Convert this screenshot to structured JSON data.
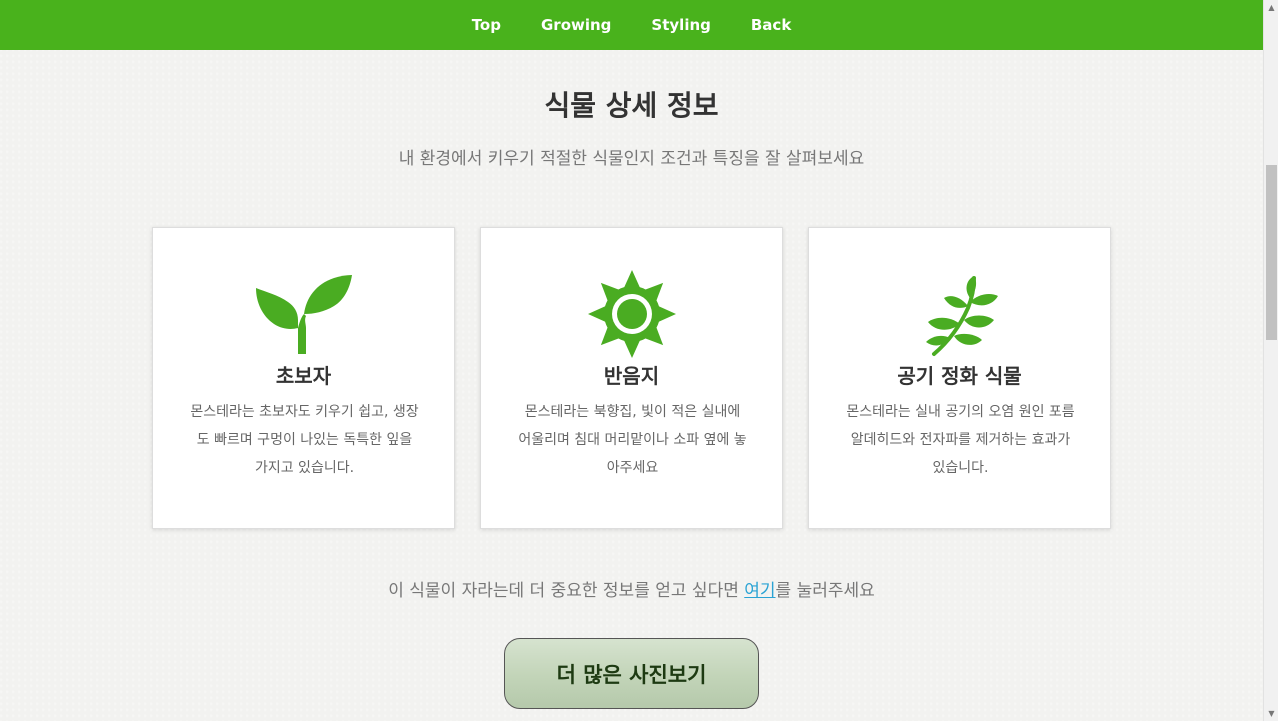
{
  "nav": {
    "items": [
      "Top",
      "Growing",
      "Styling",
      "Back"
    ]
  },
  "header": {
    "title": "식물 상세 정보",
    "subtitle": "내 환경에서 키우기 적절한 식물인지 조건과 특징을 잘 살펴보세요"
  },
  "cards": [
    {
      "icon": "sprout-icon",
      "title": "초보자",
      "lines": [
        "몬스테라는 초보자도 키우기 쉽고, 생장",
        "도 빠르며 구멍이 나있는 독특한 잎을",
        "가지고 있습니다."
      ]
    },
    {
      "icon": "sun-icon",
      "title": "반음지",
      "lines": [
        "몬스테라는 북향집, 빛이 적은 실내에",
        "어울리며 침대 머리맡이나 소파 옆에 놓",
        "아주세요"
      ]
    },
    {
      "icon": "leaf-branch-icon",
      "title": "공기 정화 식물",
      "lines": [
        "몬스테라는 실내 공기의 오염 원인 포름",
        "알데히드와 전자파를 제거하는 효과가",
        "있습니다."
      ]
    }
  ],
  "more_info": {
    "before": "이 식물이 자라는데 더 중요한 정보를 얻고 싶다면 ",
    "link": "여기",
    "after": "를 눌러주세요"
  },
  "button": {
    "label": "더 많은 사진보기"
  },
  "colors": {
    "nav_bg": "#49b21c",
    "icon_green": "#4aac22",
    "link": "#2aa3d4"
  }
}
